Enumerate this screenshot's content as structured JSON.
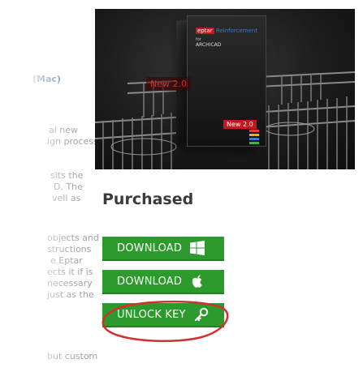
{
  "left_column": {
    "fragments": [
      {
        "text": "(Mac)",
        "style": "blue"
      },
      {
        "text": "al new",
        "style": "plain"
      },
      {
        "text": "ign process is",
        "style": "plain"
      },
      {
        "text": "sits the",
        "style": "plain"
      },
      {
        "text": "D. The",
        "style": "plain"
      },
      {
        "text": "vell as",
        "style": "plain"
      },
      {
        "text": "objects and",
        "style": "plain"
      },
      {
        "text": "structions",
        "style": "plain"
      },
      {
        "text": "e Eptar",
        "style": "plain"
      },
      {
        "text": "ects it if is",
        "style": "plain"
      },
      {
        "text": "necessary",
        "style": "plain"
      },
      {
        "text": "just as the",
        "style": "plain"
      },
      {
        "text": "but custom",
        "style": "plain"
      }
    ]
  },
  "product": {
    "brand": "eptar",
    "product_name": "Reinforcement",
    "sub_for": "for",
    "platform": "ARCHICAD",
    "badge": "New 2.0",
    "floating_badge": "New 2.0"
  },
  "purchased": {
    "title": "Purchased",
    "buttons": [
      {
        "label": "DOWNLOAD",
        "icon": "windows-icon"
      },
      {
        "label": "DOWNLOAD",
        "icon": "apple-icon"
      },
      {
        "label": "UNLOCK KEY",
        "icon": "key-icon"
      }
    ]
  },
  "colors": {
    "button_green": "#2c9a2c",
    "highlight_red": "#d62f2f",
    "title_text": "#3b3b3b"
  }
}
